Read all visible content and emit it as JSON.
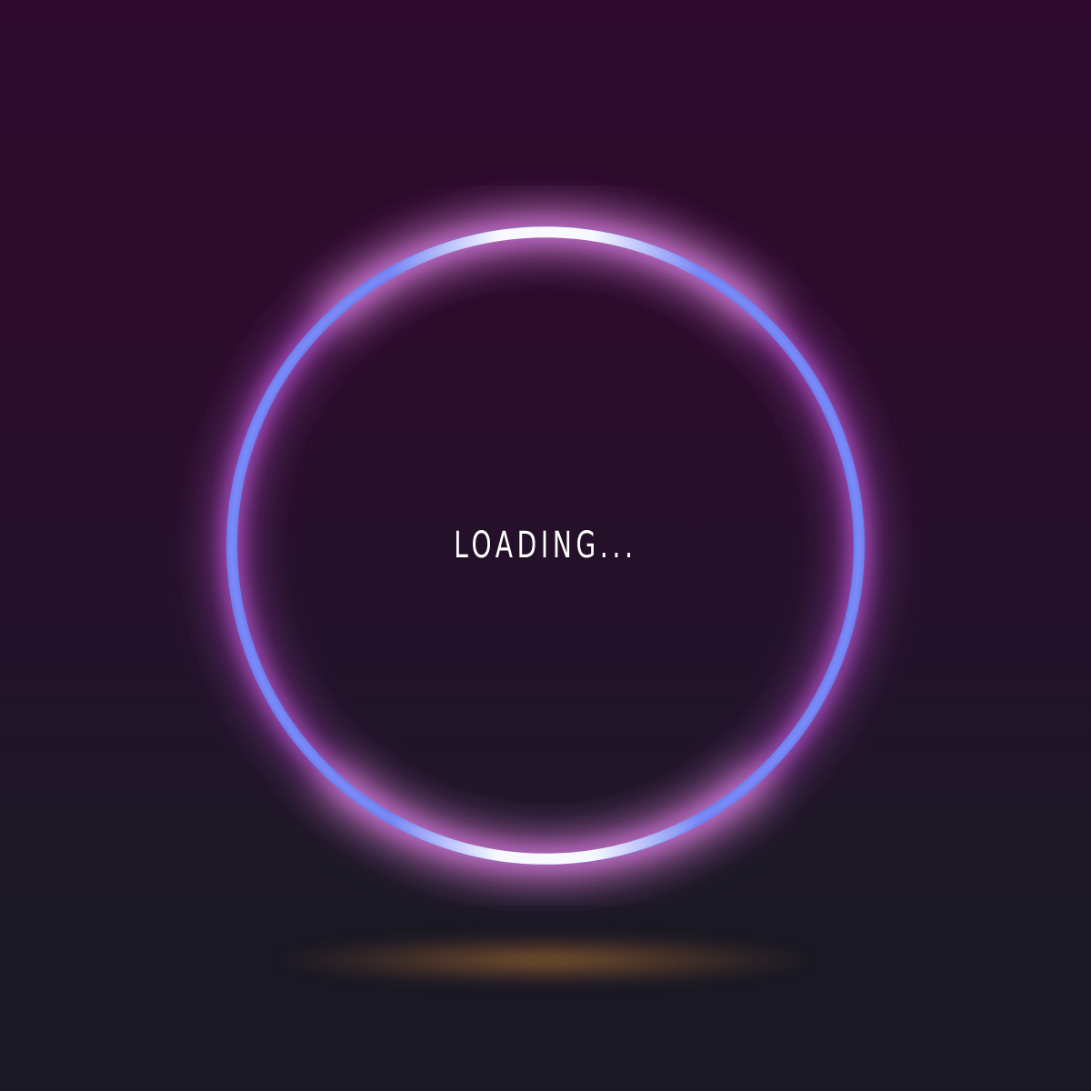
{
  "loader": {
    "label": "LOADING...",
    "ring_color": "#6a7df0",
    "glow_color": "#b04fc4",
    "highlight_color": "#ffffff",
    "shadow_color": "#c4823a"
  }
}
